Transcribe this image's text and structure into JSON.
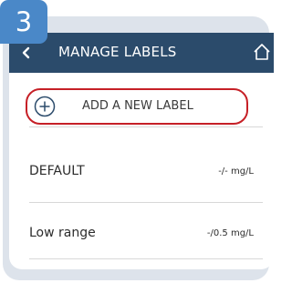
{
  "step_badge": "3",
  "header": {
    "title": "MANAGE LABELS",
    "back_icon": "chevron-left-icon",
    "home_icon": "home-icon"
  },
  "add_label_button": {
    "icon": "plus-circle-icon",
    "label": "ADD A NEW LABEL",
    "highlight_color": "#c62027"
  },
  "labels": [
    {
      "name": "DEFAULT",
      "value": "-/- mg/L"
    },
    {
      "name": "Low range",
      "value": "-/0.5 mg/L"
    }
  ],
  "colors": {
    "header_bg": "#2b4b6b",
    "badge_bg": "#4a88c8",
    "frame_bg": "#dde3eb"
  }
}
